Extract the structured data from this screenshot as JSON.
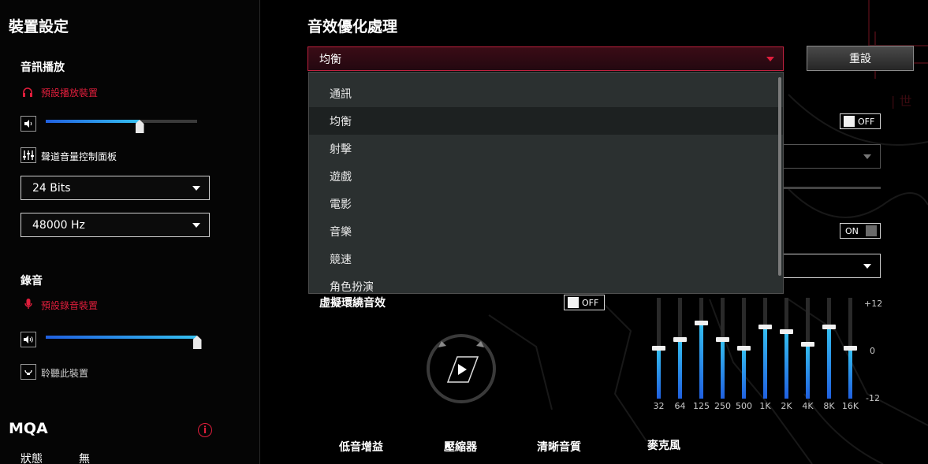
{
  "device_settings": {
    "title": "裝置設定",
    "playback": {
      "title": "音訊播放",
      "device_name": "預設播放裝置",
      "volume": 0.62,
      "channel_panel_label": "聲道音量控制面板",
      "bit_depth": "24 Bits",
      "sample_rate": "48000 Hz"
    },
    "recording": {
      "title": "錄音",
      "device_name": "預設錄音裝置",
      "volume": 1.0,
      "listen_label": "聆聽此裝置"
    },
    "mqa": {
      "title": "MQA",
      "status_label": "狀態",
      "status_value": "無"
    }
  },
  "sound_optimization": {
    "title": "音效優化處理",
    "preset_selected": "均衡",
    "reset_label": "重設",
    "dropdown_options": [
      "通訊",
      "均衡",
      "射擊",
      "遊戲",
      "電影",
      "音樂",
      "競速",
      "角色扮演"
    ],
    "dropdown_selected_index": 1,
    "toggle_1": "OFF",
    "toggle_2": "ON",
    "virtual_surround": {
      "label": "虛擬環繞音效",
      "state": "OFF"
    },
    "equalizer": {
      "bands": [
        "32",
        "64",
        "125",
        "250",
        "500",
        "1K",
        "2K",
        "4K",
        "8K",
        "16K"
      ],
      "values_db": [
        0,
        2,
        6,
        2,
        0,
        5,
        4,
        1,
        5,
        0
      ],
      "scale_top": "+12",
      "scale_mid": "0",
      "scale_bottom": "-12",
      "range_db": [
        -12,
        12
      ]
    },
    "bottom_tabs": [
      "低音增益",
      "壓縮器",
      "清晰音質",
      "麥克風"
    ]
  },
  "colors": {
    "accent_red": "#e01e3c",
    "slider_blue": "#35c0f0"
  }
}
